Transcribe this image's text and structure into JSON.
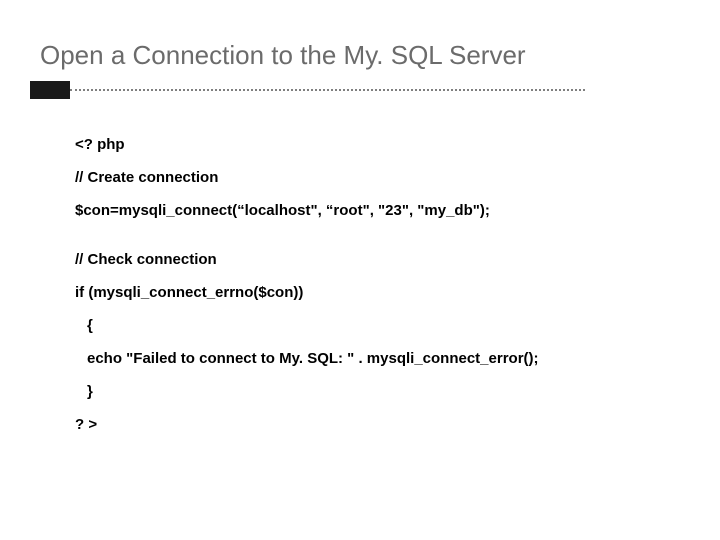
{
  "slide": {
    "title": "Open a Connection to the My. SQL Server",
    "code": {
      "line1": "<? php",
      "line2": "// Create connection",
      "line3": "$con=mysqli_connect(“localhost\", “root\", \"23\", \"my_db\");",
      "line4": "// Check connection",
      "line5": "if (mysqli_connect_errno($con))",
      "line6": "{",
      "line7": "echo \"Failed to connect to My. SQL: \" . mysqli_connect_error();",
      "line8": "}",
      "line9": "? >"
    }
  }
}
